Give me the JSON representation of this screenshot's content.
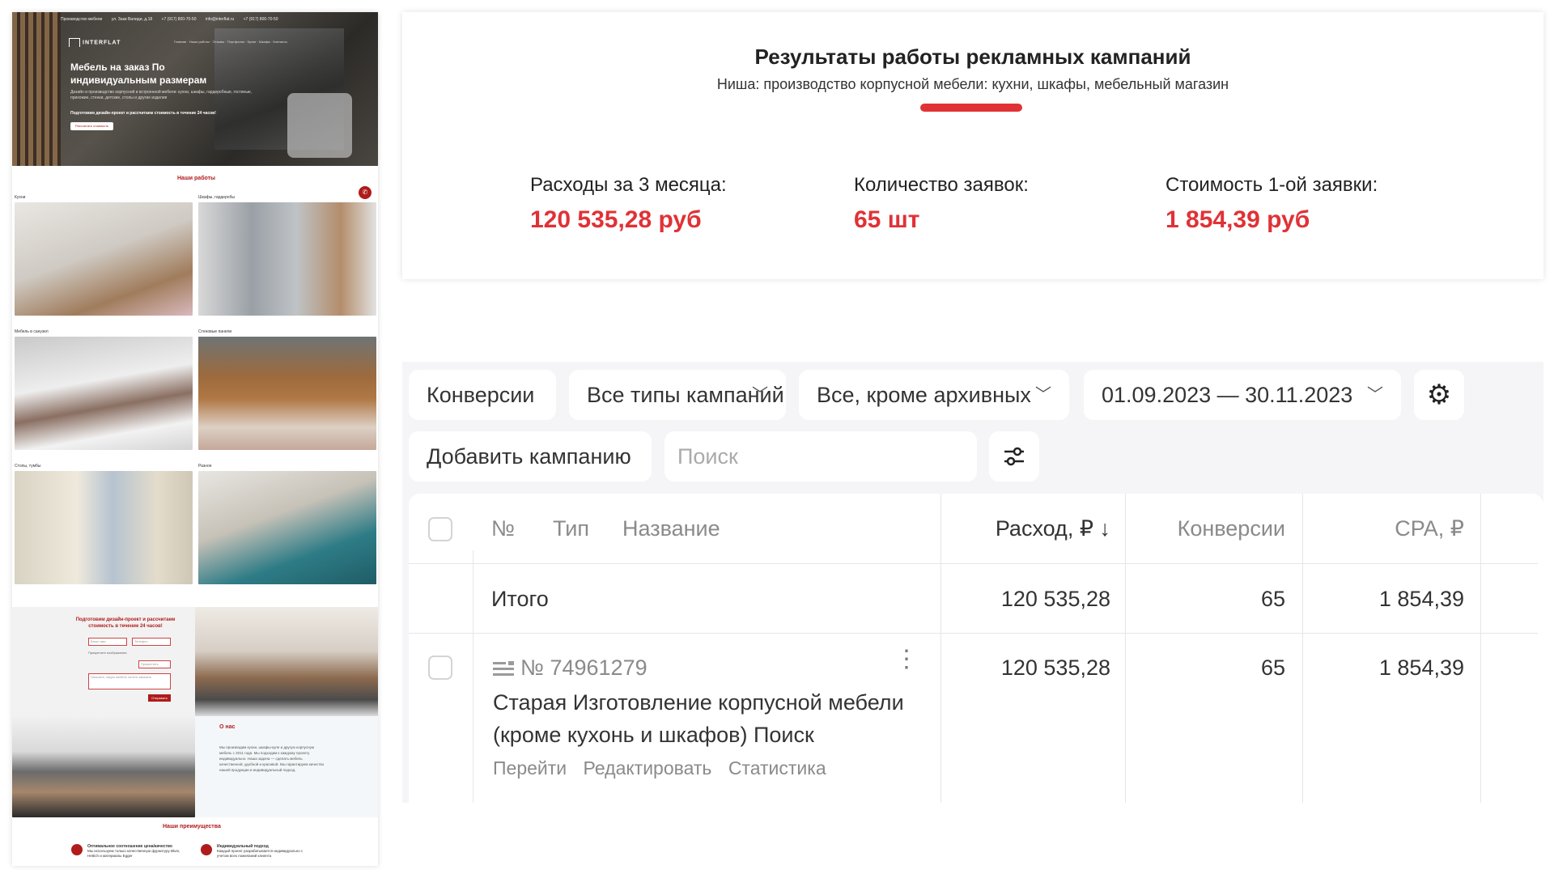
{
  "site": {
    "topbar": [
      "Производство мебели",
      "ул. Заки Валиди, д.18",
      "+7 (917) 800-70-50",
      "info@interflat.ru",
      "+7 (917) 800-70-50"
    ],
    "logo": "INTERFLAT",
    "nav": "Главная · Наши работы · Отзывы · Портфолио · Кухни · Шкафы · Контакты",
    "hero_title": "Мебель на заказ По индивидуальным размерам",
    "hero_desc": "Дизайн и производство корпусной и встроенной мебели: кухни, шкафы, гардеробные, гостиные, прихожие, стенки, детские, столы и другие изделия",
    "hero_offer": "Подготовим дизайн-проект и рассчитаем стоимость в течение 24 часов!",
    "hero_cta": "Рассчитать стоимость",
    "works_title": "Наши работы",
    "gallery": [
      {
        "caption": "Кухни"
      },
      {
        "caption": "Шкафы, гардеробы"
      },
      {
        "caption": "Мебель в санузел"
      },
      {
        "caption": "Стеновые панели"
      },
      {
        "caption": "Столы, тумбы"
      },
      {
        "caption": "Разное"
      }
    ],
    "form_title": "Подготовим дизайн-проект и рассчитаем стоимость в течение 24 часов!",
    "form_name_ph": "Ваше имя",
    "form_phone_ph": "Телефон",
    "form_note": "Прикрепите изображения",
    "form_attach": "Прикрепить",
    "form_comment_ph": "Опишите, какую мебель хотите заказать",
    "form_send": "Отправить",
    "about_title": "О нас",
    "about_text": "Мы производим кухни, шкафы-купе и другую корпусную мебель с 2011 года. Мы подходим к каждому проекту индивидуально. Наша задача — сделать мебель качественной, удобной и красивой. Мы гарантируем качество нашей продукции и индивидуальный подход.",
    "adv_title": "Наши преимущества",
    "adv": [
      {
        "title": "Оптимальное соотношение цена/качество",
        "text": "Мы используем только качественную фурнитуру Blum, Hettich и материалы Egger"
      },
      {
        "title": "Индивидуальный подход",
        "text": "Каждый проект разрабатывается индивидуально с учетом всех пожеланий клиента"
      }
    ]
  },
  "results": {
    "title": "Результаты работы рекламных кампаний",
    "niche": "Ниша: производство корпусной мебели: кухни, шкафы, мебельный магазин",
    "accent_color": "#e03236",
    "metrics": [
      {
        "label": "Расходы за 3 месяца:",
        "value": "120 535,28 руб"
      },
      {
        "label": "Количество заявок:",
        "value": "65 шт"
      },
      {
        "label": "Стоимость 1-ой заявки:",
        "value": "1 854,39 руб"
      }
    ]
  },
  "direct": {
    "filters": {
      "conversions": "Конверсии",
      "campaign_types": "Все типы кампаний",
      "status": "Все, кроме архивных",
      "date_range": "01.09.2023 — 30.11.2023"
    },
    "add_campaign": "Добавить кампанию",
    "search_placeholder": "Поиск",
    "settings_icon": "gear-icon",
    "filter_icon": "sliders-icon",
    "headers": {
      "num": "№",
      "type": "Тип",
      "name": "Название",
      "spend": "Расход, ₽ ↓",
      "conversions": "Конверсии",
      "cpa": "CPA, ₽"
    },
    "total": {
      "label": "Итого",
      "spend": "120 535,28",
      "conversions": "65",
      "cpa": "1 854,39"
    },
    "rows": [
      {
        "number": "№ 74961279",
        "name": "Старая Изготовление корпусной мебели (кроме кухонь и шкафов) Поиск",
        "spend": "120 535,28",
        "conversions": "65",
        "cpa": "1 854,39",
        "links": [
          "Перейти",
          "Редактировать",
          "Статистика"
        ]
      }
    ]
  }
}
